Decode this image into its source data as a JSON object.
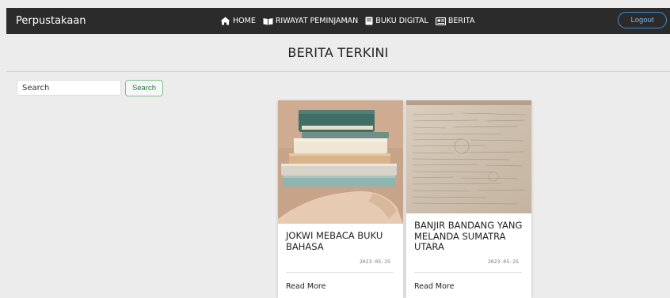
{
  "navbar": {
    "brand": "Perpustakaan",
    "items": [
      {
        "label": "HOME",
        "icon": "home-icon"
      },
      {
        "label": "RIWAYAT PEMINJAMAN",
        "icon": "book-open-icon"
      },
      {
        "label": "BUKU DIGITAL",
        "icon": "book-icon"
      },
      {
        "label": "BERITA",
        "icon": "newspaper-icon"
      }
    ],
    "logout_label": "Logout"
  },
  "header": {
    "title": "BERITA TERKINI"
  },
  "search": {
    "placeholder": "Search",
    "value": "",
    "button_label": "Search"
  },
  "articles": [
    {
      "title": "JOKWI MEBACA BUKU BAHASA",
      "date": "2023-05-25",
      "read_more": "Read More",
      "image": "book-stack-photo"
    },
    {
      "title": "BANJIR BANDANG YANG MELANDA SUMATRA UTARA",
      "date": "2023-05-25",
      "read_more": "Read More",
      "image": "old-manuscript-photo"
    }
  ],
  "colors": {
    "navbar_bg": "#2b2b2b",
    "page_bg": "#ececec",
    "logout_accent": "#3f8ed1",
    "search_accent": "#7bbf8e"
  }
}
